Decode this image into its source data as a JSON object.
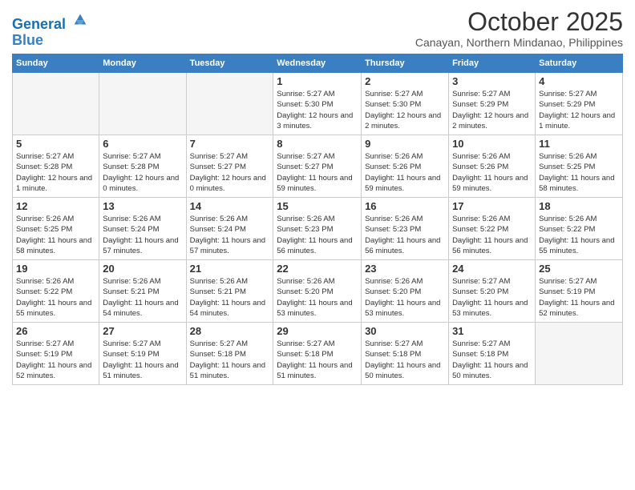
{
  "header": {
    "logo_line1": "General",
    "logo_line2": "Blue",
    "month": "October 2025",
    "location": "Canayan, Northern Mindanao, Philippines"
  },
  "weekdays": [
    "Sunday",
    "Monday",
    "Tuesday",
    "Wednesday",
    "Thursday",
    "Friday",
    "Saturday"
  ],
  "weeks": [
    [
      {
        "day": "",
        "empty": true
      },
      {
        "day": "",
        "empty": true
      },
      {
        "day": "",
        "empty": true
      },
      {
        "day": "1",
        "sunrise": "5:27 AM",
        "sunset": "5:30 PM",
        "daylight": "12 hours and 3 minutes."
      },
      {
        "day": "2",
        "sunrise": "5:27 AM",
        "sunset": "5:30 PM",
        "daylight": "12 hours and 2 minutes."
      },
      {
        "day": "3",
        "sunrise": "5:27 AM",
        "sunset": "5:29 PM",
        "daylight": "12 hours and 2 minutes."
      },
      {
        "day": "4",
        "sunrise": "5:27 AM",
        "sunset": "5:29 PM",
        "daylight": "12 hours and 1 minute."
      }
    ],
    [
      {
        "day": "5",
        "sunrise": "5:27 AM",
        "sunset": "5:28 PM",
        "daylight": "12 hours and 1 minute."
      },
      {
        "day": "6",
        "sunrise": "5:27 AM",
        "sunset": "5:28 PM",
        "daylight": "12 hours and 0 minutes."
      },
      {
        "day": "7",
        "sunrise": "5:27 AM",
        "sunset": "5:27 PM",
        "daylight": "12 hours and 0 minutes."
      },
      {
        "day": "8",
        "sunrise": "5:27 AM",
        "sunset": "5:27 PM",
        "daylight": "11 hours and 59 minutes."
      },
      {
        "day": "9",
        "sunrise": "5:26 AM",
        "sunset": "5:26 PM",
        "daylight": "11 hours and 59 minutes."
      },
      {
        "day": "10",
        "sunrise": "5:26 AM",
        "sunset": "5:26 PM",
        "daylight": "11 hours and 59 minutes."
      },
      {
        "day": "11",
        "sunrise": "5:26 AM",
        "sunset": "5:25 PM",
        "daylight": "11 hours and 58 minutes."
      }
    ],
    [
      {
        "day": "12",
        "sunrise": "5:26 AM",
        "sunset": "5:25 PM",
        "daylight": "11 hours and 58 minutes."
      },
      {
        "day": "13",
        "sunrise": "5:26 AM",
        "sunset": "5:24 PM",
        "daylight": "11 hours and 57 minutes."
      },
      {
        "day": "14",
        "sunrise": "5:26 AM",
        "sunset": "5:24 PM",
        "daylight": "11 hours and 57 minutes."
      },
      {
        "day": "15",
        "sunrise": "5:26 AM",
        "sunset": "5:23 PM",
        "daylight": "11 hours and 56 minutes."
      },
      {
        "day": "16",
        "sunrise": "5:26 AM",
        "sunset": "5:23 PM",
        "daylight": "11 hours and 56 minutes."
      },
      {
        "day": "17",
        "sunrise": "5:26 AM",
        "sunset": "5:22 PM",
        "daylight": "11 hours and 56 minutes."
      },
      {
        "day": "18",
        "sunrise": "5:26 AM",
        "sunset": "5:22 PM",
        "daylight": "11 hours and 55 minutes."
      }
    ],
    [
      {
        "day": "19",
        "sunrise": "5:26 AM",
        "sunset": "5:22 PM",
        "daylight": "11 hours and 55 minutes."
      },
      {
        "day": "20",
        "sunrise": "5:26 AM",
        "sunset": "5:21 PM",
        "daylight": "11 hours and 54 minutes."
      },
      {
        "day": "21",
        "sunrise": "5:26 AM",
        "sunset": "5:21 PM",
        "daylight": "11 hours and 54 minutes."
      },
      {
        "day": "22",
        "sunrise": "5:26 AM",
        "sunset": "5:20 PM",
        "daylight": "11 hours and 53 minutes."
      },
      {
        "day": "23",
        "sunrise": "5:26 AM",
        "sunset": "5:20 PM",
        "daylight": "11 hours and 53 minutes."
      },
      {
        "day": "24",
        "sunrise": "5:27 AM",
        "sunset": "5:20 PM",
        "daylight": "11 hours and 53 minutes."
      },
      {
        "day": "25",
        "sunrise": "5:27 AM",
        "sunset": "5:19 PM",
        "daylight": "11 hours and 52 minutes."
      }
    ],
    [
      {
        "day": "26",
        "sunrise": "5:27 AM",
        "sunset": "5:19 PM",
        "daylight": "11 hours and 52 minutes."
      },
      {
        "day": "27",
        "sunrise": "5:27 AM",
        "sunset": "5:19 PM",
        "daylight": "11 hours and 51 minutes."
      },
      {
        "day": "28",
        "sunrise": "5:27 AM",
        "sunset": "5:18 PM",
        "daylight": "11 hours and 51 minutes."
      },
      {
        "day": "29",
        "sunrise": "5:27 AM",
        "sunset": "5:18 PM",
        "daylight": "11 hours and 51 minutes."
      },
      {
        "day": "30",
        "sunrise": "5:27 AM",
        "sunset": "5:18 PM",
        "daylight": "11 hours and 50 minutes."
      },
      {
        "day": "31",
        "sunrise": "5:27 AM",
        "sunset": "5:18 PM",
        "daylight": "11 hours and 50 minutes."
      },
      {
        "day": "",
        "empty": true
      }
    ]
  ]
}
